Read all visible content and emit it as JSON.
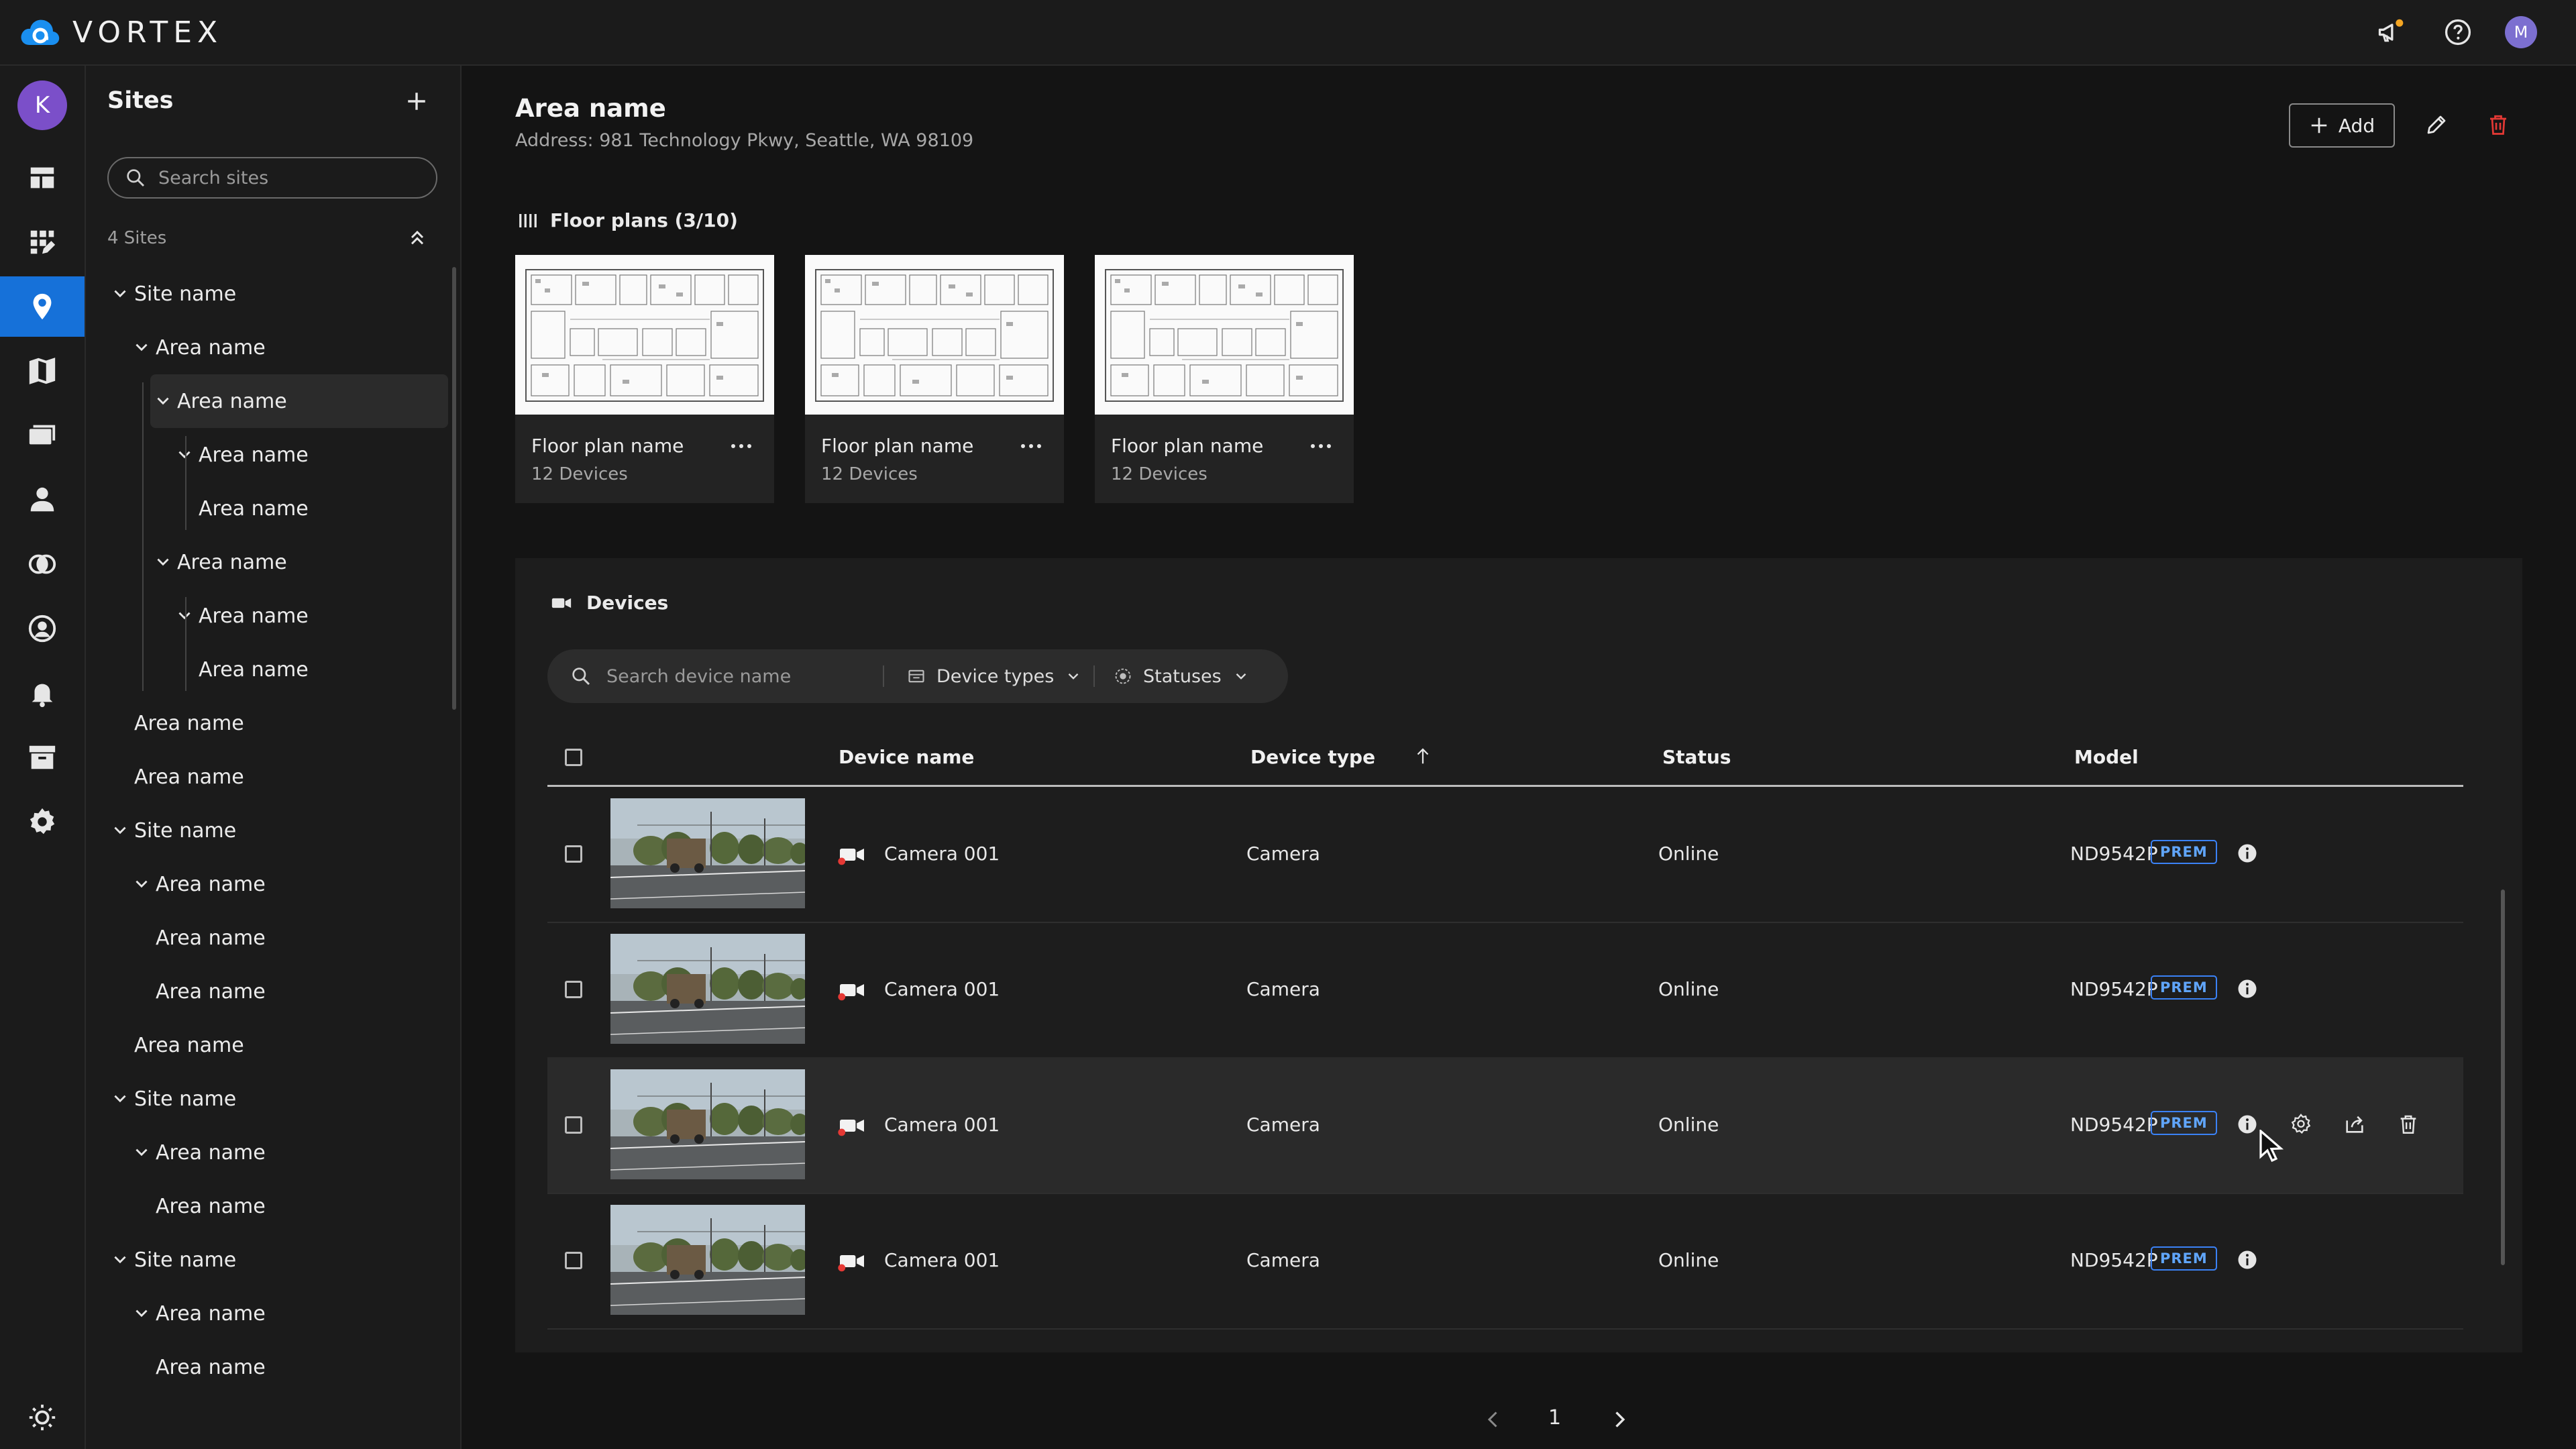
{
  "app": {
    "brand": "VORTEX",
    "user_initial": "M",
    "accent": "#1671d9"
  },
  "rail": {
    "account_initial": "K",
    "items": [
      "dashboard-icon",
      "widgets-edit-icon",
      "location-pin-icon",
      "map-icon",
      "video-wall-icon",
      "person-icon",
      "integrations-icon",
      "account-circle-icon",
      "bell-icon",
      "archive-icon",
      "settings-icon"
    ],
    "active_index": 2
  },
  "sites": {
    "title": "Sites",
    "search_placeholder": "Search sites",
    "count": "4 Sites",
    "tree": [
      {
        "label": "Site name",
        "depth": 0,
        "chevron": true
      },
      {
        "label": "Area name",
        "depth": 1,
        "chevron": true
      },
      {
        "label": "Area name",
        "depth": 2,
        "chevron": true,
        "selected": true
      },
      {
        "label": "Area name",
        "depth": 3,
        "chevron": true
      },
      {
        "label": "Area name",
        "depth": 3,
        "chevron": false
      },
      {
        "label": "Area name",
        "depth": 2,
        "chevron": true
      },
      {
        "label": "Area name",
        "depth": 3,
        "chevron": true
      },
      {
        "label": "Area name",
        "depth": 3,
        "chevron": false
      },
      {
        "label": "Area name",
        "depth": 0,
        "chevron": false
      },
      {
        "label": "Area name",
        "depth": 0,
        "chevron": false
      },
      {
        "label": "Site name",
        "depth": 0,
        "chevron": true
      },
      {
        "label": "Area name",
        "depth": 1,
        "chevron": true
      },
      {
        "label": "Area name",
        "depth": 1,
        "chevron": false
      },
      {
        "label": "Area name",
        "depth": 1,
        "chevron": false
      },
      {
        "label": "Area name",
        "depth": 0,
        "chevron": false
      },
      {
        "label": "Site name",
        "depth": 0,
        "chevron": true
      },
      {
        "label": "Area name",
        "depth": 1,
        "chevron": true
      },
      {
        "label": "Area name",
        "depth": 1,
        "chevron": false
      },
      {
        "label": "Site name",
        "depth": 0,
        "chevron": true
      },
      {
        "label": "Area name",
        "depth": 1,
        "chevron": true
      },
      {
        "label": "Area name",
        "depth": 1,
        "chevron": false
      }
    ]
  },
  "area": {
    "title": "Area name",
    "address": "Address: 981 Technology Pkwy, Seattle, WA 98109",
    "add_label": "Add"
  },
  "floor_plans": {
    "header": "Floor plans (3/10)",
    "cards": [
      {
        "name": "Floor plan name",
        "devices": "12 Devices"
      },
      {
        "name": "Floor plan name",
        "devices": "12 Devices"
      },
      {
        "name": "Floor plan name",
        "devices": "12 Devices"
      }
    ]
  },
  "devices": {
    "header": "Devices",
    "search_placeholder": "Search device name",
    "filter_types": "Device types",
    "filter_statuses": "Statuses",
    "columns": {
      "name": "Device name",
      "type": "Device type",
      "status": "Status",
      "model": "Model"
    },
    "rows": [
      {
        "name": "Camera 001",
        "type": "Camera",
        "status": "Online",
        "model": "ND9542P",
        "badge": "PREM",
        "hover": false
      },
      {
        "name": "Camera 001",
        "type": "Camera",
        "status": "Online",
        "model": "ND9542P",
        "badge": "PREM",
        "hover": false
      },
      {
        "name": "Camera 001",
        "type": "Camera",
        "status": "Online",
        "model": "ND9542P",
        "badge": "PREM",
        "hover": true
      },
      {
        "name": "Camera 001",
        "type": "Camera",
        "status": "Online",
        "model": "ND9542P",
        "badge": "PREM",
        "hover": false
      }
    ]
  },
  "pagination": {
    "page": "1"
  }
}
